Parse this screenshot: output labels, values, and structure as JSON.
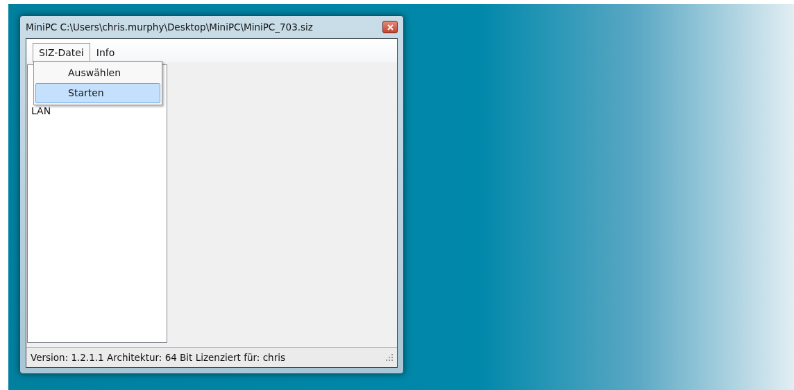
{
  "window": {
    "title": "MiniPC C:\\Users\\chris.murphy\\Desktop\\MiniPC\\MiniPC_703.siz"
  },
  "menu": [
    {
      "label": "SIZ-Datei",
      "selected": true
    },
    {
      "label": "Info",
      "selected": false
    }
  ],
  "dropdown": [
    {
      "label": "Auswählen",
      "selected": false
    },
    {
      "label": "Starten",
      "selected": true
    }
  ],
  "list": {
    "items": [
      "LAN"
    ]
  },
  "status_bar": "Version: 1.2.1.1 Architektur: 64 Bit Lizenziert für: chris"
}
